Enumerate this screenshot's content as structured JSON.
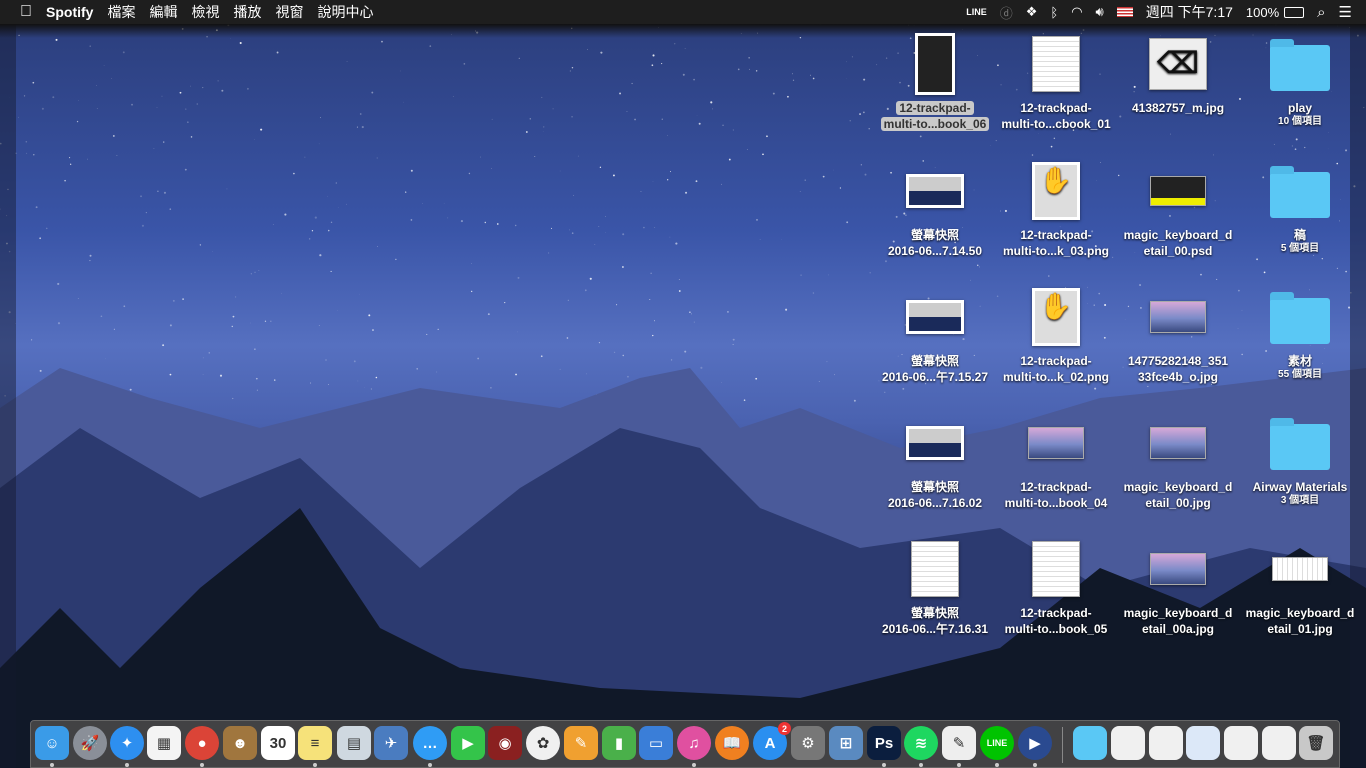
{
  "menubar": {
    "apple": "",
    "app": "Spotify",
    "items": [
      "檔案",
      "編輯",
      "檢視",
      "播放",
      "視窗",
      "說明中心"
    ],
    "status": {
      "line": "LINE",
      "datetime": "週四 下午7:17",
      "battery": "100%"
    }
  },
  "desktop": [
    {
      "l1": "12-trackpad-",
      "l2": "multi-to...book_06",
      "kind": "doc-dark",
      "selected": true
    },
    {
      "l1": "12-trackpad-",
      "l2": "multi-to...cbook_01",
      "kind": "doc"
    },
    {
      "l1": "41382757_m.jpg",
      "l2": "",
      "kind": "delete"
    },
    {
      "l1": "play",
      "sub": "10 個項目",
      "kind": "folder"
    },
    {
      "l1": "螢幕快照",
      "l2": "2016-06...7.14.50",
      "kind": "shot"
    },
    {
      "l1": "12-trackpad-",
      "l2": "multi-to...k_03.png",
      "kind": "hand"
    },
    {
      "l1": "magic_keyboard_d",
      "l2": "etail_00.psd",
      "kind": "psd"
    },
    {
      "l1": "稿",
      "sub": "5 個項目",
      "kind": "folder"
    },
    {
      "l1": "螢幕快照",
      "l2": "2016-06...午7.15.27",
      "kind": "shot"
    },
    {
      "l1": "12-trackpad-",
      "l2": "multi-to...k_02.png",
      "kind": "hand"
    },
    {
      "l1": "14775282148_351",
      "l2": "33fce4b_o.jpg",
      "kind": "photo"
    },
    {
      "l1": "素材",
      "sub": "55 個項目",
      "kind": "folder"
    },
    {
      "l1": "螢幕快照",
      "l2": "2016-06...7.16.02",
      "kind": "shot"
    },
    {
      "l1": "12-trackpad-",
      "l2": "multi-to...book_04",
      "kind": "photo"
    },
    {
      "l1": "magic_keyboard_d",
      "l2": "etail_00.jpg",
      "kind": "photo"
    },
    {
      "l1": "Airway Materials",
      "sub": "3 個項目",
      "kind": "folder"
    },
    {
      "l1": "螢幕快照",
      "l2": "2016-06...午7.16.31",
      "kind": "doc"
    },
    {
      "l1": "12-trackpad-",
      "l2": "multi-to...book_05",
      "kind": "doc"
    },
    {
      "l1": "magic_keyboard_d",
      "l2": "etail_00a.jpg",
      "kind": "photo"
    },
    {
      "l1": "magic_keyboard_d",
      "l2": "etail_01.jpg",
      "kind": "keyboard"
    }
  ],
  "dock": [
    {
      "id": "finder",
      "g": "☺",
      "c": "#3a9be8",
      "run": true
    },
    {
      "id": "launchpad",
      "g": "🚀",
      "c": "#8a8f98"
    },
    {
      "id": "safari",
      "g": "✦",
      "c": "#2d8ff0",
      "run": true
    },
    {
      "id": "app-grid",
      "g": "▦",
      "c": "#f4f4f4"
    },
    {
      "id": "chrome",
      "g": "●",
      "c": "#db4437",
      "run": true
    },
    {
      "id": "contacts",
      "g": "☻",
      "c": "#a0763e"
    },
    {
      "id": "calendar",
      "g": "30",
      "c": "#ffffff"
    },
    {
      "id": "notes",
      "g": "≡",
      "c": "#f6e27a",
      "run": true
    },
    {
      "id": "preview",
      "g": "▤",
      "c": "#cfd8e0"
    },
    {
      "id": "image-capture",
      "g": "✈",
      "c": "#4a7cc0"
    },
    {
      "id": "messages",
      "g": "…",
      "c": "#2f9cf5",
      "run": true
    },
    {
      "id": "facetime",
      "g": "▶",
      "c": "#34c44a"
    },
    {
      "id": "photo-booth",
      "g": "◉",
      "c": "#8a2020"
    },
    {
      "id": "photos",
      "g": "✿",
      "c": "#f0f0f0"
    },
    {
      "id": "pages",
      "g": "✎",
      "c": "#f0a030"
    },
    {
      "id": "numbers",
      "g": "▮",
      "c": "#4ab04a"
    },
    {
      "id": "keynote",
      "g": "▭",
      "c": "#3a7ed8"
    },
    {
      "id": "itunes",
      "g": "♫",
      "c": "#e050a0",
      "run": true
    },
    {
      "id": "ibooks",
      "g": "📖",
      "c": "#f08020"
    },
    {
      "id": "app-store",
      "g": "A",
      "c": "#2a8ff0",
      "badge": "2"
    },
    {
      "id": "system-preferences",
      "g": "⚙",
      "c": "#777"
    },
    {
      "id": "remote-desktop",
      "g": "⊞",
      "c": "#5a8ac0"
    },
    {
      "id": "photoshop",
      "g": "Ps",
      "c": "#0b1e3e",
      "run": true
    },
    {
      "id": "spotify",
      "g": "≋",
      "c": "#1ed760",
      "run": true
    },
    {
      "id": "textedit",
      "g": "✎",
      "c": "#eeeeee",
      "run": true
    },
    {
      "id": "line",
      "g": "LINE",
      "c": "#00c300",
      "run": true
    },
    {
      "id": "quicktime",
      "g": "▶",
      "c": "#2a4a90",
      "run": true
    },
    {
      "id": "folder-stack",
      "g": "",
      "c": "#5ac8f5"
    },
    {
      "id": "doc-stack-1",
      "g": "",
      "c": "#f0f0f0"
    },
    {
      "id": "doc-stack-2",
      "g": "",
      "c": "#f0f0f0"
    },
    {
      "id": "doc-stack-3",
      "g": "",
      "c": "#dce8f8"
    },
    {
      "id": "doc-stack-4",
      "g": "",
      "c": "#f0f0f0"
    },
    {
      "id": "doc-stack-5",
      "g": "",
      "c": "#f0f0f0"
    },
    {
      "id": "trash",
      "g": "🗑",
      "c": "#c8c8c8"
    }
  ]
}
